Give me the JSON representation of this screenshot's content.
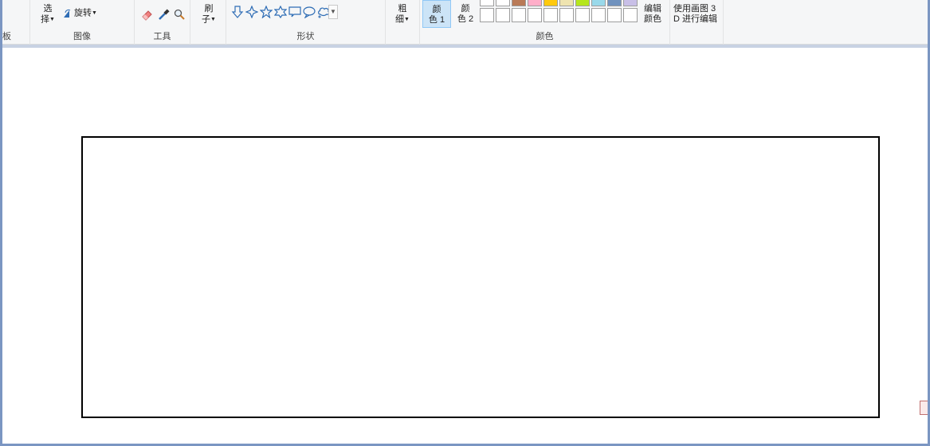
{
  "ribbon": {
    "clipboard": {
      "label": "板"
    },
    "image": {
      "label": "图像",
      "select_line1": "选",
      "select_line2": "择",
      "rotate_label": "旋转"
    },
    "tools": {
      "label": "工具"
    },
    "brushes": {
      "line1": "刷",
      "line2": "子"
    },
    "shapes": {
      "label": "形状"
    },
    "size": {
      "line1": "粗",
      "line2": "细"
    },
    "colors": {
      "label": "颜色",
      "color1_line1": "颜",
      "color1_line2": "色 1",
      "color2_line1": "颜",
      "color2_line2": "色 2",
      "edit_line1": "编辑",
      "edit_line2": "颜色",
      "palette_top": [
        "#ffffff",
        "#ffffff",
        "#b97a57",
        "#ffaec9",
        "#ffc90e",
        "#efe4b0",
        "#b5e61d",
        "#99d9ea",
        "#7092be",
        "#c8bfe7"
      ]
    },
    "paint3d": {
      "line1": "使用画图 3",
      "line2": "D 进行编辑"
    }
  },
  "icons": [
    "eraser-icon",
    "color-picker-icon",
    "magnifier-icon",
    "rotate-icon",
    "arrow-down-shape-icon",
    "star4-shape-icon",
    "star5-shape-icon",
    "star6-shape-icon",
    "rect-callout-shape-icon",
    "oval-callout-shape-icon",
    "cloud-callout-shape-icon"
  ],
  "colors": {
    "accent": "#cce4f7",
    "accent_border": "#90c8f6",
    "frame": "#7b96c2"
  }
}
